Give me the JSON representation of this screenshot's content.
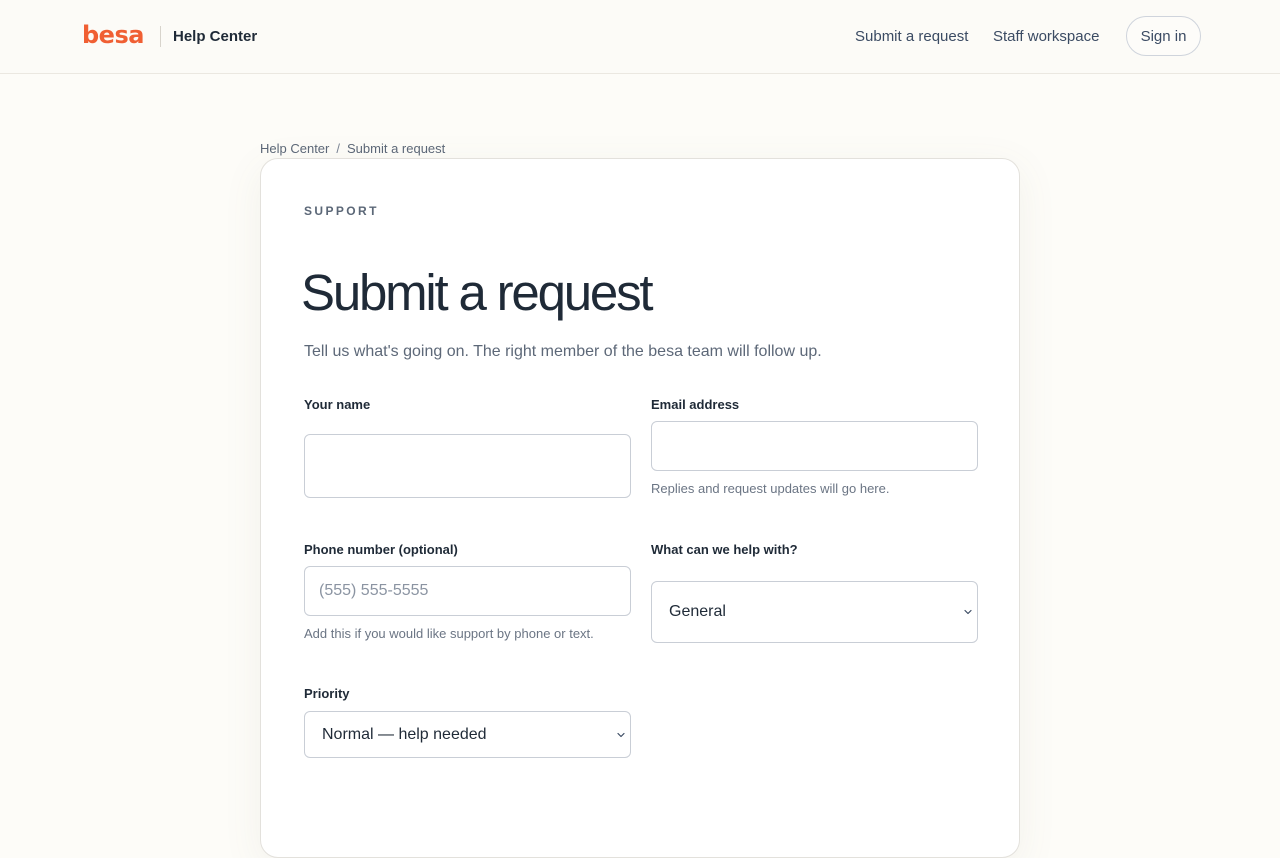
{
  "header": {
    "logo_text": "besa",
    "brand_title": "Help Center",
    "nav": {
      "submit_request": "Submit a request",
      "staff_workspace": "Staff workspace",
      "sign_in": "Sign in"
    }
  },
  "breadcrumb": {
    "home": "Help Center",
    "separator": "/",
    "current": "Submit a request"
  },
  "form": {
    "eyebrow": "SUPPORT",
    "title": "Submit a request",
    "intro": "Tell us what's going on. The right member of the besa team will follow up.",
    "name": {
      "label": "Your name",
      "value": "",
      "placeholder": ""
    },
    "email": {
      "label": "Email address",
      "value": "",
      "placeholder": "",
      "help": "Replies and request updates will go here."
    },
    "phone": {
      "label": "Phone number (optional)",
      "value": "",
      "placeholder": "(555) 555-5555",
      "help": "Add this if you would like support by phone or text."
    },
    "topic": {
      "label": "What can we help with?",
      "selected": "General"
    },
    "priority": {
      "label": "Priority",
      "selected": "Normal — help needed"
    }
  },
  "colors": {
    "brand": "#f05f33",
    "page_background": "#fdfcf8",
    "text_primary": "#1f2a37",
    "text_muted": "#5d6878",
    "field_border": "#c9ced6"
  },
  "icons": {
    "select_chevron": "chevron-down-icon"
  }
}
